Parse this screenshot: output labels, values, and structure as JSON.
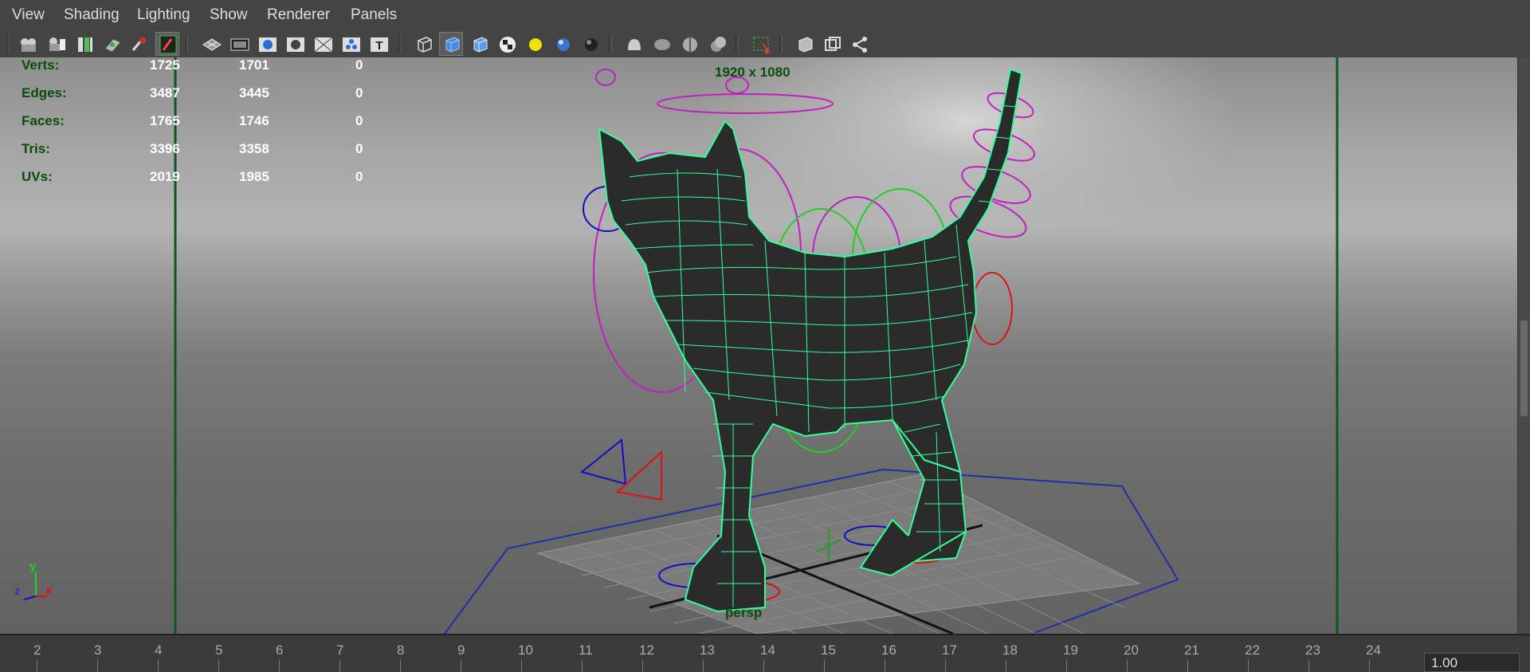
{
  "menu": [
    "View",
    "Shading",
    "Lighting",
    "Show",
    "Renderer",
    "Panels"
  ],
  "toolbar_icons": [
    "camera-select-icon",
    "camera-attributes-icon",
    "bookmarks-icon",
    "image-plane-icon",
    "2d-pan-zoom-icon",
    "grease-pencil-icon",
    "grid-icon",
    "film-gate-icon",
    "resolution-gate-icon",
    "gate-mask-icon",
    "field-chart-icon",
    "safe-action-icon",
    "safe-title-icon",
    "wireframe-icon",
    "smooth-shade-icon",
    "use-default-material-icon",
    "texture-checker-icon",
    "use-all-lights-icon",
    "shadows-icon",
    "ambient-occlusion-icon",
    "motion-blur-icon",
    "anti-aliasing-icon",
    "depth-of-field-icon",
    "isolate-select-icon",
    "xray-icon",
    "xray-active-components-icon",
    "xray-joints-icon"
  ],
  "hud": {
    "rows": [
      {
        "label": "Verts:",
        "a": "1725",
        "b": "1701",
        "c": "0"
      },
      {
        "label": "Edges:",
        "a": "3487",
        "b": "3445",
        "c": "0"
      },
      {
        "label": "Faces:",
        "a": "1765",
        "b": "1746",
        "c": "0"
      },
      {
        "label": "Tris:",
        "a": "3396",
        "b": "3358",
        "c": "0"
      },
      {
        "label": "UVs:",
        "a": "2019",
        "b": "1985",
        "c": "0"
      }
    ],
    "resolution": "1920 x 1080",
    "camera": "persp",
    "axes": {
      "x": "x",
      "y": "y",
      "z": "z"
    }
  },
  "timeline": {
    "ticks": [
      "2",
      "3",
      "4",
      "5",
      "6",
      "7",
      "8",
      "9",
      "10",
      "11",
      "12",
      "13",
      "14",
      "15",
      "16",
      "17",
      "18",
      "19",
      "20",
      "21",
      "22",
      "23",
      "24"
    ],
    "current": "1.00"
  },
  "colors": {
    "wire": "#33ff99",
    "gate": "#0a5a20",
    "control_red": "#e01010",
    "control_magenta": "#c020c0",
    "control_blue": "#1010c0",
    "control_green": "#20d020",
    "hud_label": "#0a4d0a"
  }
}
